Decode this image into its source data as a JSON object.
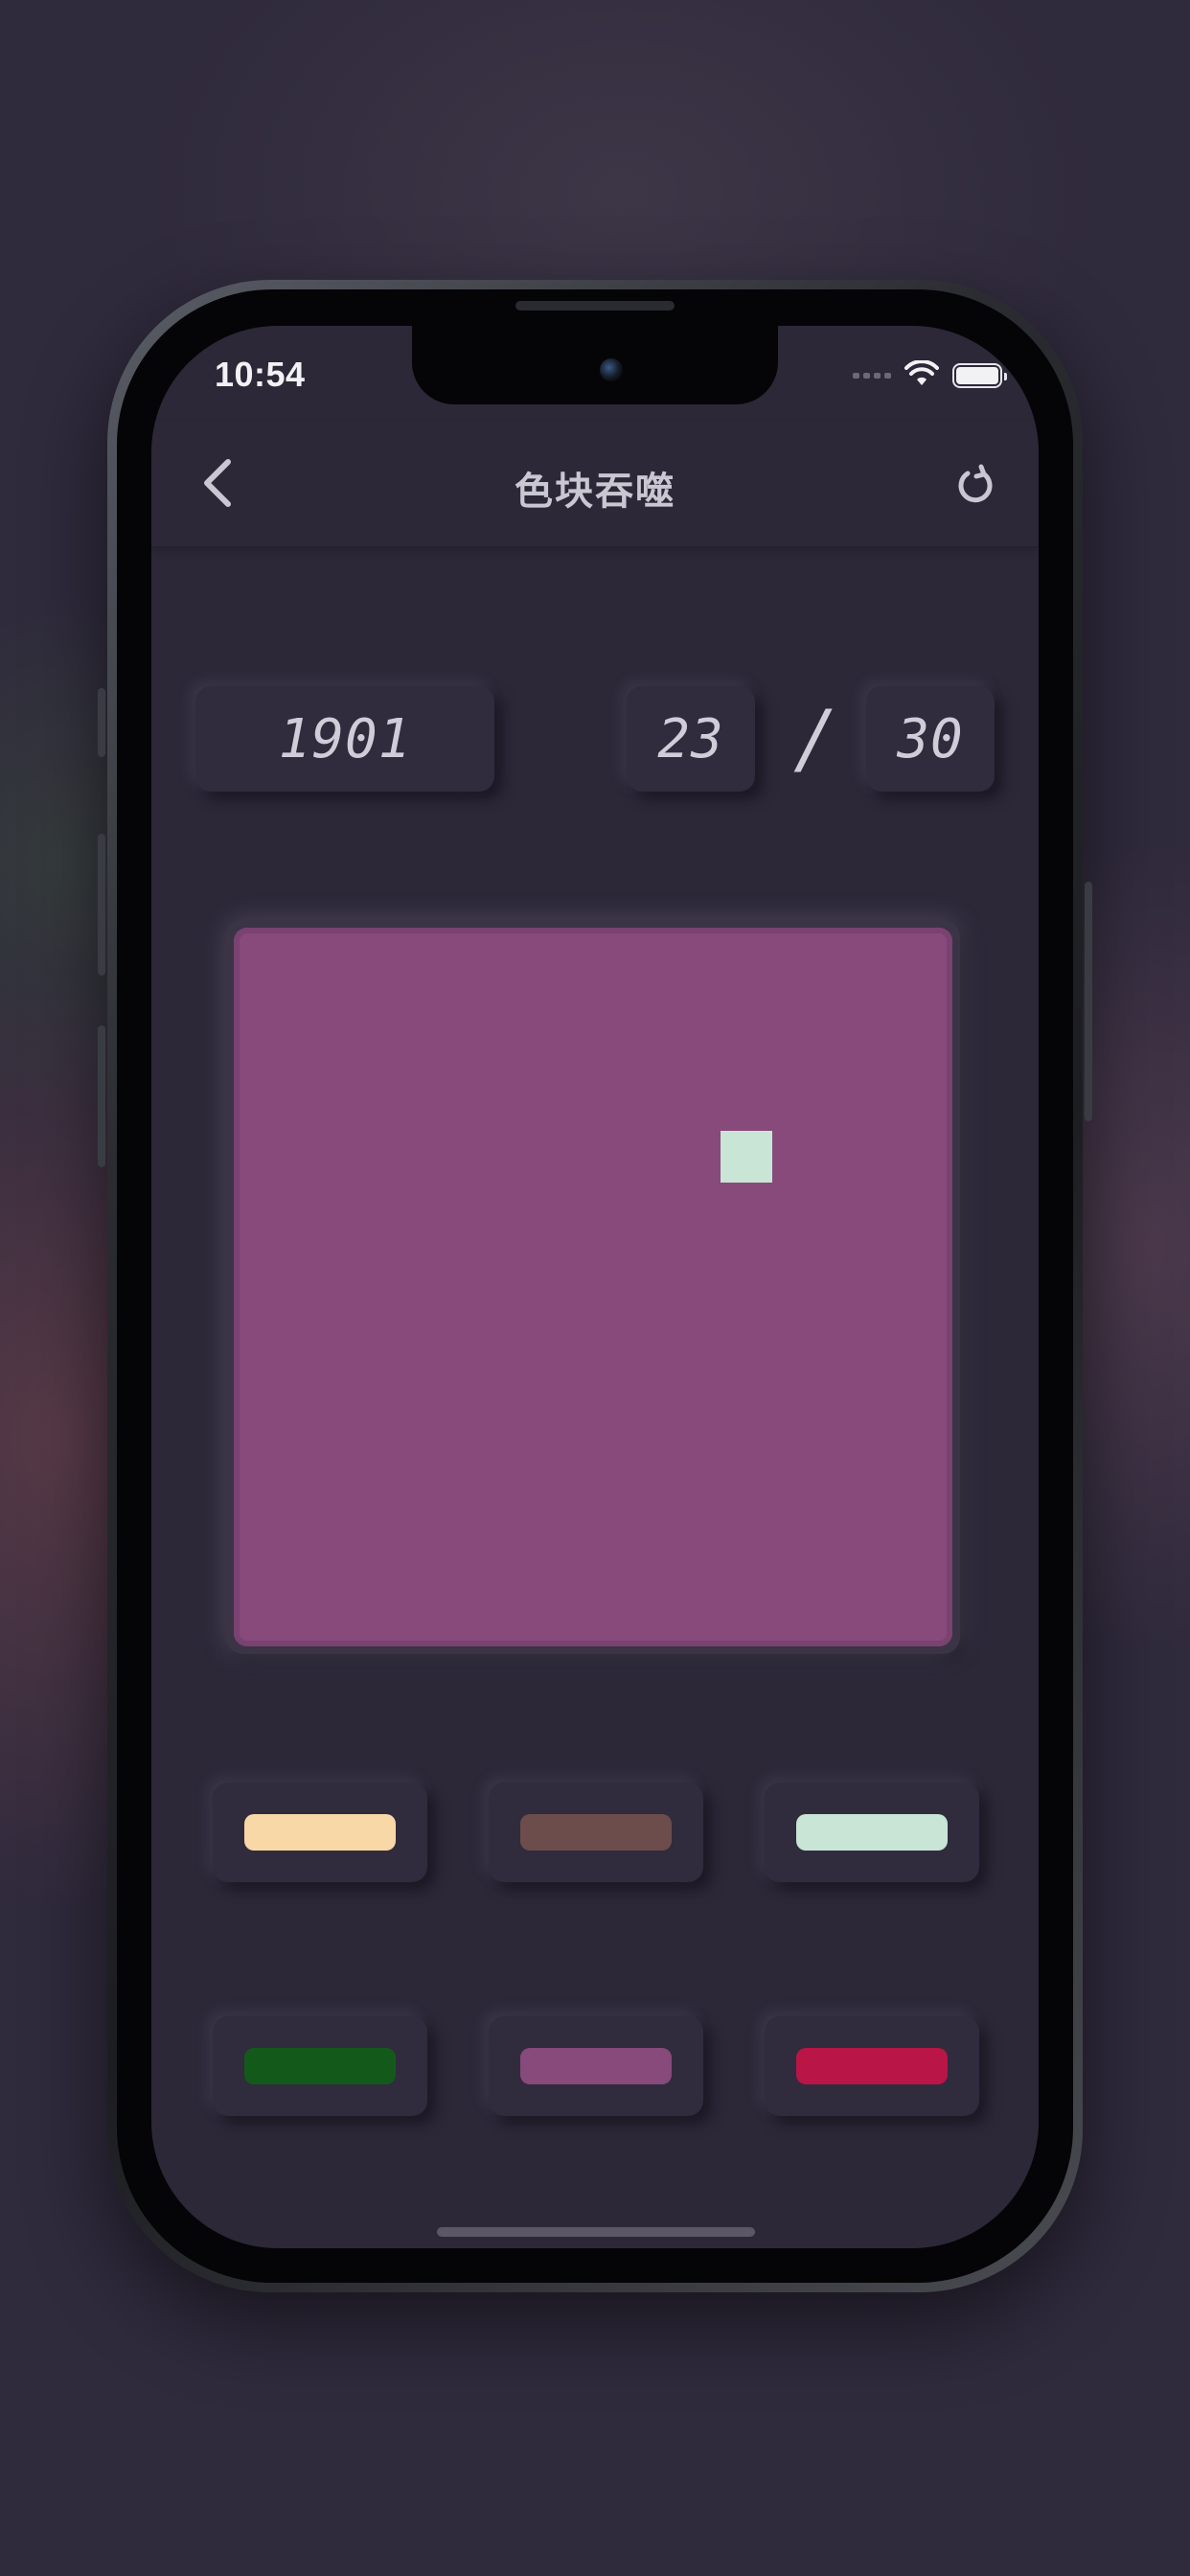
{
  "status_bar": {
    "time": "10:54"
  },
  "nav": {
    "title": "色块吞噬"
  },
  "game": {
    "score": "1901",
    "moves_used": "23",
    "separator": "/",
    "moves_total": "30",
    "board_color": "#874a7a",
    "board_cell_color": "#c8e5d6"
  },
  "palette": [
    {
      "name": "cream",
      "color": "#f8d8a6"
    },
    {
      "name": "brown",
      "color": "#6c4d4c"
    },
    {
      "name": "mint",
      "color": "#c8e5d6"
    },
    {
      "name": "dark-green",
      "color": "#135a1a"
    },
    {
      "name": "purple",
      "color": "#874a7a"
    },
    {
      "name": "crimson",
      "color": "#b91547"
    }
  ],
  "icons": {
    "back": "chevron-left-icon",
    "refresh": "refresh-icon",
    "wifi": "wifi-icon",
    "battery": "battery-icon",
    "signal": "signal-icon"
  }
}
